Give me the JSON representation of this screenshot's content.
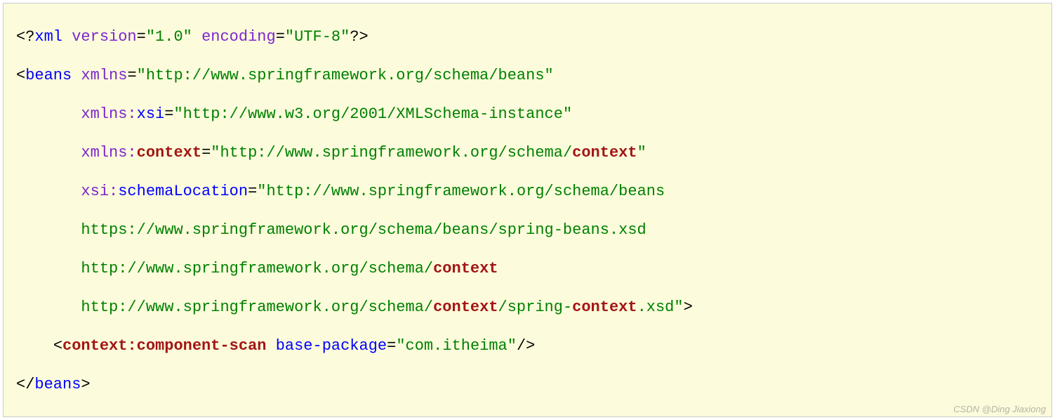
{
  "code": {
    "l1": {
      "open": "<?",
      "xml": "xml",
      "sp1": " ",
      "versionAttr": "version",
      "eq1": "=",
      "versionVal": "\"1.0\"",
      "sp2": " ",
      "encodingAttr": "encoding",
      "eq2": "=",
      "encodingVal": "\"UTF-8\"",
      "close": "?>"
    },
    "l2": {
      "open": "<",
      "beans": "beans",
      "sp": " ",
      "xmlnsAttr": "xmlns",
      "eq": "=",
      "xmlnsVal": "\"http://www.springframework.org/schema/beans\""
    },
    "l3": {
      "indent": "       ",
      "xmlnsPrefix": "xmlns:",
      "xsi": "xsi",
      "eq": "=",
      "xsiVal": "\"http://www.w3.org/2001/XMLSchema-instance\""
    },
    "l4": {
      "indent": "       ",
      "xmlnsPrefix": "xmlns:",
      "context": "context",
      "eq": "=",
      "q1": "\"",
      "urlPre": "http://www.springframework.org/schema/",
      "urlCtx": "context",
      "q2": "\""
    },
    "l5": {
      "indent": "       ",
      "xsiPrefix": "xsi:",
      "schemaLoc": "schemaLocation",
      "eq": "=",
      "q": "\"",
      "val": "http://www.springframework.org/schema/beans"
    },
    "l6": {
      "indent": "       ",
      "val": "https://www.springframework.org/schema/beans/spring-beans.xsd"
    },
    "l7": {
      "indent": "       ",
      "urlPre": "http://www.springframework.org/schema/",
      "ctx": "context"
    },
    "l8": {
      "indent": "       ",
      "urlPre": "http://www.springframework.org/schema/",
      "ctx1": "context",
      "mid": "/spring-",
      "ctx2": "context",
      "xsd": ".xsd",
      "q": "\"",
      "gt": ">"
    },
    "l9": {
      "indent": "    ",
      "lt": "<",
      "ctx": "context",
      "colon": ":",
      "scan": "component-scan",
      "sp": " ",
      "baseAttr": "base-package",
      "eq": "=",
      "baseVal": "\"com.itheima\"",
      "close": "/>"
    },
    "l10": {
      "open": "</",
      "beans": "beans",
      "gt": ">"
    }
  },
  "watermark": "CSDN @Ding Jiaxiong"
}
